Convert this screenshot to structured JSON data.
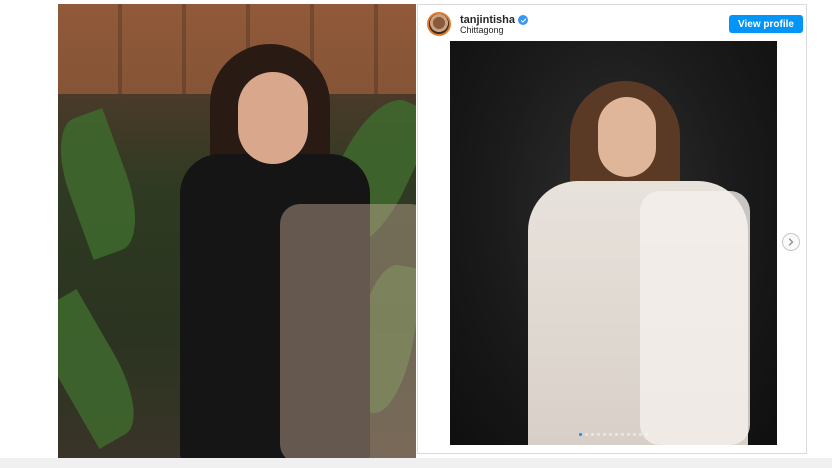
{
  "post": {
    "username": "tanjintisha",
    "location": "Chittagong",
    "view_profile_label": "View profile",
    "carousel": {
      "total": 12,
      "active_index": 0
    }
  },
  "icons": {
    "verified": "verified-badge-icon",
    "next": "chevron-right-icon"
  },
  "colors": {
    "accent": "#0095f6",
    "verified": "#3897f0"
  }
}
